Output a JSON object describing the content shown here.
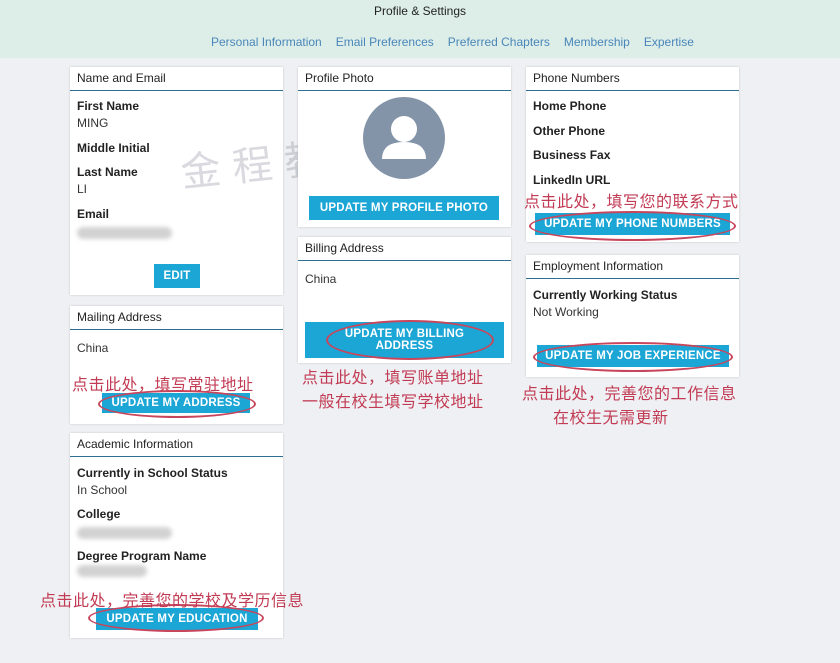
{
  "header": {
    "title": "Profile & Settings",
    "tabs": [
      "Personal Information",
      "Email Preferences",
      "Preferred Chapters",
      "Membership",
      "Expertise"
    ]
  },
  "name_email": {
    "header": "Name and Email",
    "first_name_label": "First Name",
    "first_name": "MING",
    "middle_initial_label": "Middle Initial",
    "last_name_label": "Last Name",
    "last_name": "LI",
    "email_label": "Email",
    "edit_button": "EDIT"
  },
  "mailing": {
    "header": "Mailing Address",
    "value": "China",
    "button": "UPDATE MY ADDRESS"
  },
  "academic": {
    "header": "Academic Information",
    "status_label": "Currently in School Status",
    "status": "In School",
    "college_label": "College",
    "degree_label": "Degree Program Name",
    "button": "UPDATE MY EDUCATION"
  },
  "photo": {
    "header": "Profile Photo",
    "button": "UPDATE MY PROFILE PHOTO"
  },
  "billing": {
    "header": "Billing Address",
    "value": "China",
    "button_line1": "UPDATE MY BILLING",
    "button_line2": "ADDRESS"
  },
  "phone": {
    "header": "Phone Numbers",
    "home_label": "Home Phone",
    "other_label": "Other Phone",
    "fax_label": "Business Fax",
    "linkedin_label": "LinkedIn URL",
    "button": "UPDATE MY PHONE NUMBERS"
  },
  "employment": {
    "header": "Employment Information",
    "status_label": "Currently Working Status",
    "status": "Not Working",
    "button": "UPDATE MY JOB EXPERIENCE"
  },
  "annotations": {
    "phone": "点击此处，填写您的联系方式",
    "address": "点击此处，填写常驻地址",
    "billing1": "点击此处，填写账单地址",
    "billing2": "一般在校生填写学校地址",
    "job1": "点击此处，完善您的工作信息",
    "job2": "在校生无需更新",
    "education": "点击此处，完善您的学校及学历信息"
  },
  "watermark": "金程教育",
  "colors": {
    "accent": "#1ba6d6",
    "header_bg": "#ddeee9",
    "annotation": "#c23b54",
    "divider": "#2f6f91"
  }
}
